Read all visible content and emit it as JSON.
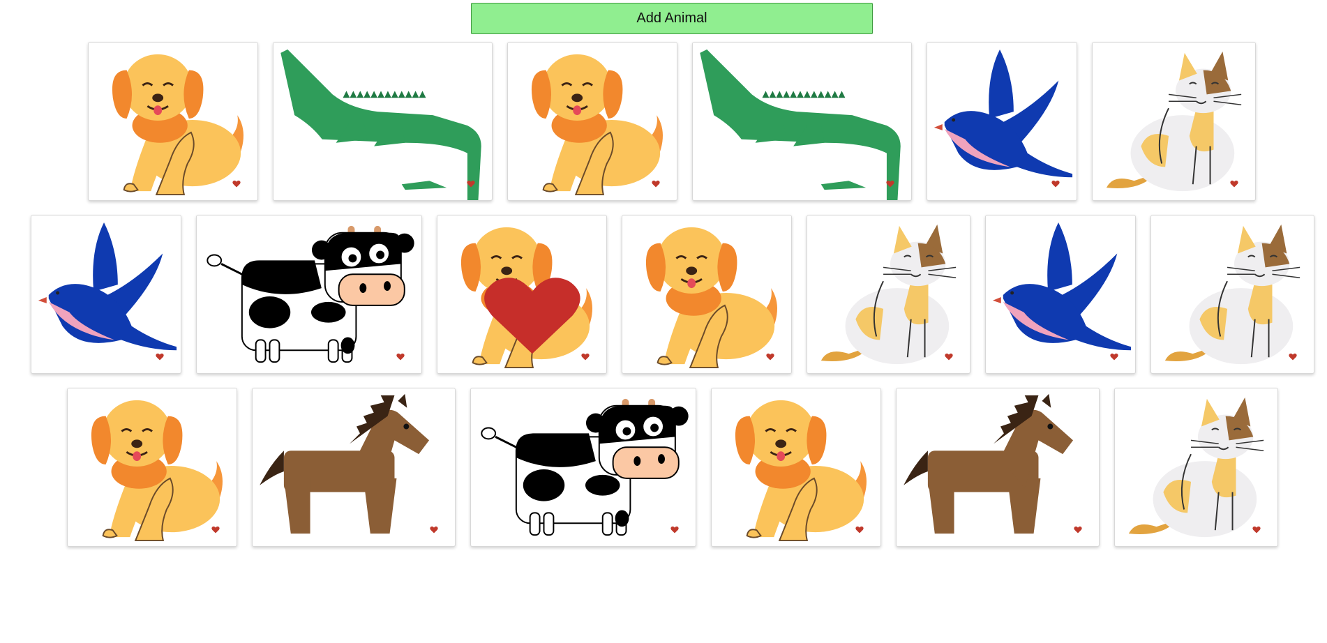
{
  "header": {
    "add_button_label": "Add Animal"
  },
  "colors": {
    "button_bg": "#90ee90",
    "heart": "#c0392b"
  },
  "rows": [
    {
      "cards": [
        "dog",
        "crocodile",
        "dog",
        "crocodile",
        "bird",
        "cat"
      ]
    },
    {
      "cards": [
        "bird",
        "cow",
        "dog-heart",
        "dog",
        "cat",
        "bird",
        "cat"
      ]
    },
    {
      "cards": [
        "dog",
        "horse",
        "cow",
        "dog",
        "horse",
        "cat"
      ]
    }
  ]
}
